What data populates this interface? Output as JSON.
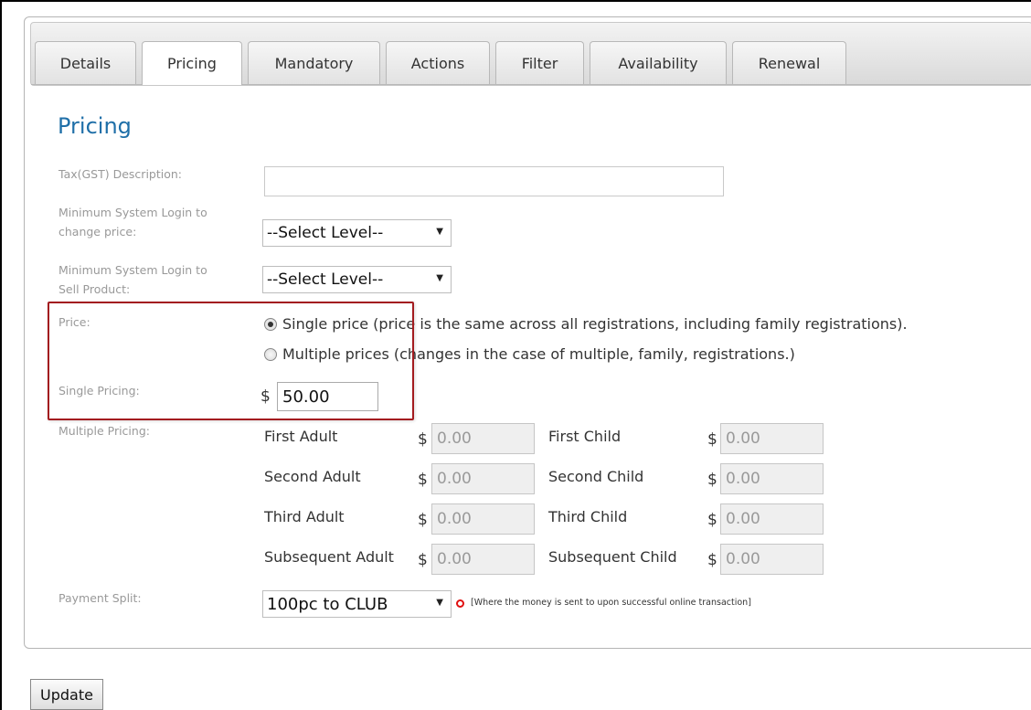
{
  "tabs": [
    {
      "label": "Details"
    },
    {
      "label": "Pricing"
    },
    {
      "label": "Mandatory"
    },
    {
      "label": "Actions"
    },
    {
      "label": "Filter"
    },
    {
      "label": "Availability"
    },
    {
      "label": "Renewal"
    }
  ],
  "active_tab": "Pricing",
  "section_title": "Pricing",
  "fields": {
    "tax_label": "Tax(GST) Description:",
    "tax_value": "",
    "min_change_label_1": "Minimum System Login to",
    "min_change_label_2": "change price:",
    "min_change_value": "--Select Level--",
    "min_sell_label_1": "Minimum System Login to",
    "min_sell_label_2": "Sell Product:",
    "min_sell_value": "--Select Level--",
    "price_label": "Price:",
    "single_price_option": "Single price (price is the same across all registrations, including family registrations).",
    "multiple_price_option": "Multiple prices (changes in the case of multiple, family, registrations.)",
    "selected_option": "single",
    "single_pricing_label": "Single Pricing:",
    "currency": "$",
    "single_pricing_value": "50.00",
    "multiple_pricing_label": "Multiple Pricing:",
    "payment_split_label": "Payment Split:",
    "payment_split_value": "100pc to CLUB",
    "payment_split_note": "[Where the money is sent to upon successful online transaction]"
  },
  "multiple_pricing": [
    {
      "label": "First Adult",
      "value": "0.00"
    },
    {
      "label": "First Child",
      "value": "0.00"
    },
    {
      "label": "Second Adult",
      "value": "0.00"
    },
    {
      "label": "Second Child",
      "value": "0.00"
    },
    {
      "label": "Third Adult",
      "value": "0.00"
    },
    {
      "label": "Third Child",
      "value": "0.00"
    },
    {
      "label": "Subsequent Adult",
      "value": "0.00"
    },
    {
      "label": "Subsequent Child",
      "value": "0.00"
    }
  ],
  "update_button": "Update",
  "icons": {
    "caret": "chevron-down-icon",
    "required": "required-marker-icon"
  },
  "colors": {
    "title": "#1f6fa8",
    "highlight": "#a31b1f",
    "required_marker": "#e01010"
  }
}
